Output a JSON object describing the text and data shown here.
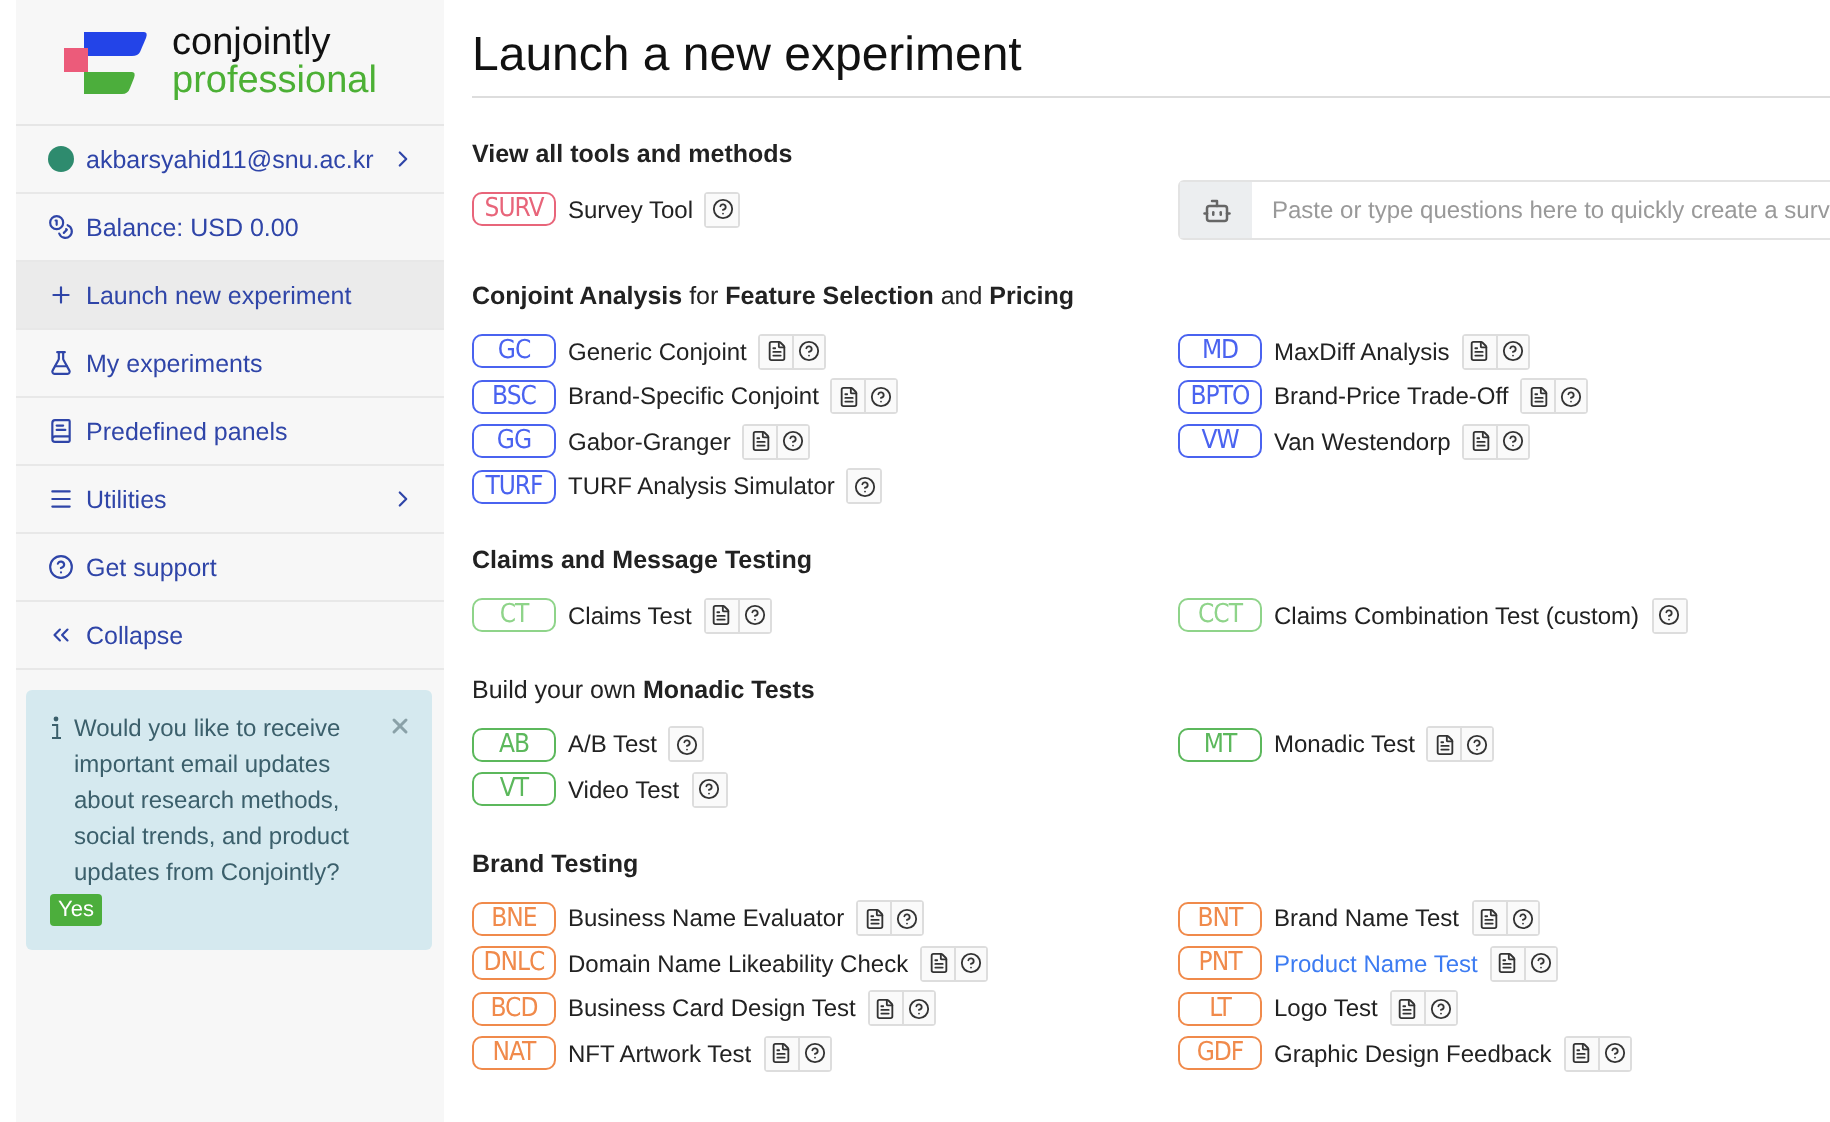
{
  "logo": {
    "brand": "conjointly",
    "edition": "professional"
  },
  "sidebar": {
    "items": [
      {
        "kind": "account",
        "label": "akbarsyahid11@snu.ac.kr",
        "expandable": true,
        "selected": false
      },
      {
        "kind": "balance",
        "label": "Balance: USD 0.00",
        "expandable": false,
        "selected": false
      },
      {
        "kind": "launch",
        "label": "Launch new experiment",
        "expandable": false,
        "selected": true
      },
      {
        "kind": "experiments",
        "label": "My experiments",
        "expandable": false,
        "selected": false
      },
      {
        "kind": "panels",
        "label": "Predefined panels",
        "expandable": false,
        "selected": false
      },
      {
        "kind": "utilities",
        "label": "Utilities",
        "expandable": true,
        "selected": false
      },
      {
        "kind": "support",
        "label": "Get support",
        "expandable": false,
        "selected": false
      },
      {
        "kind": "collapse",
        "label": "Collapse",
        "expandable": false,
        "selected": false
      }
    ],
    "notice": {
      "text": "Would you like to receive important email updates about research methods, social trends, and product updates from Conjointly?",
      "button": "Yes"
    }
  },
  "page": {
    "title": "Launch a new experiment"
  },
  "sections": [
    {
      "heading": "View all tools and methods",
      "bold": true,
      "left": [
        {
          "code": "SURV",
          "name": "Survey Tool",
          "color": "#e8657a",
          "guide": false,
          "link": false
        }
      ],
      "ai_field": {
        "placeholder": "Paste or type questions here to quickly create a surv"
      }
    },
    {
      "heading": "**Conjoint Analysis** for **Feature Selection** and **Pricing**",
      "bold": false,
      "left": [
        {
          "code": "GC",
          "name": "Generic Conjoint",
          "color": "#4a63f0",
          "guide": true,
          "link": false
        },
        {
          "code": "BSC",
          "name": "Brand-Specific Conjoint",
          "color": "#4a63f0",
          "guide": true,
          "link": false
        },
        {
          "code": "GG",
          "name": "Gabor-Granger",
          "color": "#4a63f0",
          "guide": true,
          "link": false
        },
        {
          "code": "TURF",
          "name": "TURF Analysis Simulator",
          "color": "#4a63f0",
          "guide": false,
          "link": false
        }
      ],
      "right": [
        {
          "code": "MD",
          "name": "MaxDiff Analysis",
          "color": "#4a63f0",
          "guide": true,
          "link": false
        },
        {
          "code": "BPTO",
          "name": "Brand-Price Trade-Off",
          "color": "#4a63f0",
          "guide": true,
          "link": false
        },
        {
          "code": "VW",
          "name": "Van Westendorp",
          "color": "#4a63f0",
          "guide": true,
          "link": false
        }
      ]
    },
    {
      "heading": "Claims and Message Testing",
      "bold": true,
      "left": [
        {
          "code": "CT",
          "name": "Claims Test",
          "color": "#8fd48a",
          "guide": true,
          "link": false
        }
      ],
      "right": [
        {
          "code": "CCT",
          "name": "Claims Combination Test (custom)",
          "color": "#8fd48a",
          "guide": false,
          "link": false
        }
      ]
    },
    {
      "heading": "Build your own **Monadic Tests**",
      "bold": false,
      "left": [
        {
          "code": "AB",
          "name": "A/B Test",
          "color": "#5cb85c",
          "guide": false,
          "link": false
        },
        {
          "code": "VT",
          "name": "Video Test",
          "color": "#5cb85c",
          "guide": false,
          "link": false
        }
      ],
      "right": [
        {
          "code": "MT",
          "name": "Monadic Test",
          "color": "#5cb85c",
          "guide": true,
          "link": false
        }
      ]
    },
    {
      "heading": "Brand Testing",
      "bold": true,
      "left": [
        {
          "code": "BNE",
          "name": "Business Name Evaluator",
          "color": "#f08a4b",
          "guide": true,
          "link": false
        },
        {
          "code": "DNLC",
          "name": "Domain Name Likeability Check",
          "color": "#f08a4b",
          "guide": true,
          "link": false
        },
        {
          "code": "BCD",
          "name": "Business Card Design Test",
          "color": "#f08a4b",
          "guide": true,
          "link": false
        },
        {
          "code": "NAT",
          "name": "NFT Artwork Test",
          "color": "#f08a4b",
          "guide": true,
          "link": false
        }
      ],
      "right": [
        {
          "code": "BNT",
          "name": "Brand Name Test",
          "color": "#f08a4b",
          "guide": true,
          "link": false
        },
        {
          "code": "PNT",
          "name": "Product Name Test",
          "color": "#f08a4b",
          "guide": true,
          "link": true
        },
        {
          "code": "LT",
          "name": "Logo Test",
          "color": "#f08a4b",
          "guide": true,
          "link": false
        },
        {
          "code": "GDF",
          "name": "Graphic Design Feedback",
          "color": "#f08a4b",
          "guide": true,
          "link": false
        }
      ]
    }
  ]
}
